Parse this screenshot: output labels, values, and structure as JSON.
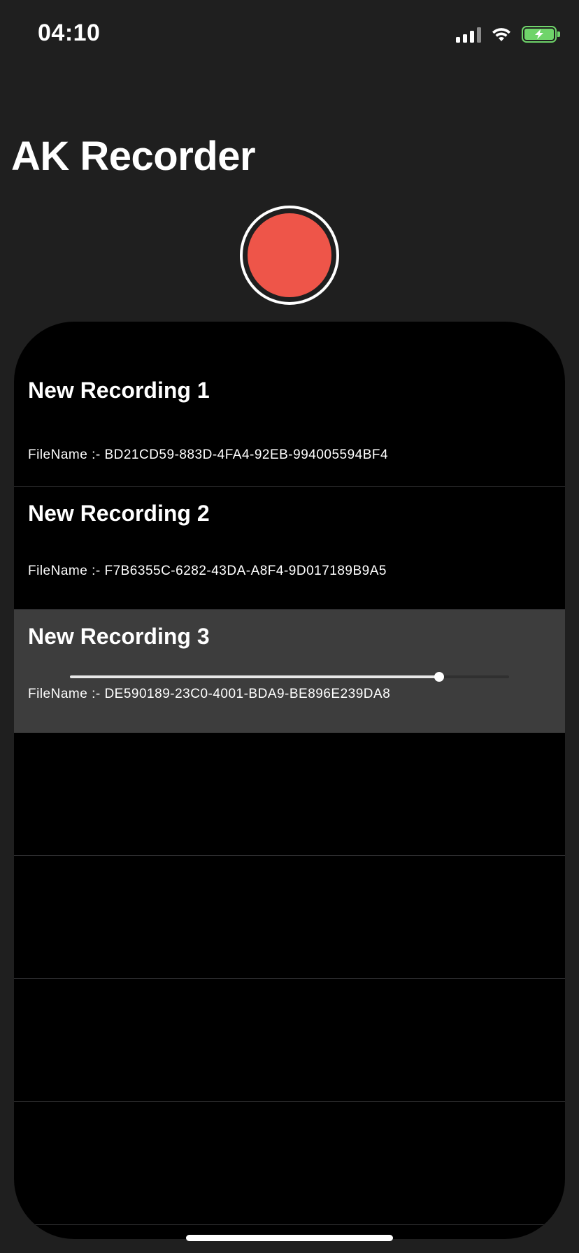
{
  "status_bar": {
    "time": "04:10",
    "icons": [
      "cellular-signal-icon",
      "wifi-icon",
      "battery-charging-icon"
    ],
    "battery_color": "#6fd46a"
  },
  "app": {
    "title": "AK Recorder",
    "record_color": "#ee5549"
  },
  "recordings": [
    {
      "title": "New Recording 1",
      "filename": "FileName :- BD21CD59-883D-4FA4-92EB-994005594BF4",
      "selected": false
    },
    {
      "title": "New Recording 2",
      "filename": "FileName :- F7B6355C-6282-43DA-A8F4-9D017189B9A5",
      "selected": false
    },
    {
      "title": "New Recording 3",
      "filename": "FileName :- DE590189-23C0-4001-BDA9-BE896E239DA8",
      "selected": true,
      "playback_progress": 0.84
    }
  ],
  "empty_rows": 4
}
